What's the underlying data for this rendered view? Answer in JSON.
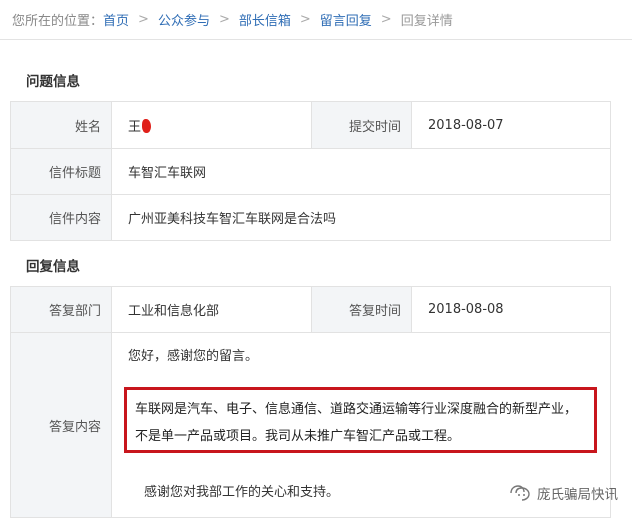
{
  "breadcrumb": {
    "prefix": "您所在的位置：",
    "items": [
      "首页",
      "公众参与",
      "部长信箱",
      "留言回复"
    ],
    "current": "回复详情"
  },
  "question": {
    "section_title": "问题信息",
    "name_label": "姓名",
    "name_value": "王",
    "time_label": "提交时间",
    "time_value": "2018-08-07",
    "subject_label": "信件标题",
    "subject_value": "车智汇车联网",
    "content_label": "信件内容",
    "content_value": "广州亚美科技车智汇车联网是合法吗"
  },
  "reply": {
    "section_title": "回复信息",
    "dept_label": "答复部门",
    "dept_value": "工业和信息化部",
    "time_label": "答复时间",
    "time_value": "2018-08-08",
    "content_label": "答复内容",
    "greeting": "您好，感谢您的留言。",
    "body": "车联网是汽车、电子、信息通信、道路交通运输等行业深度融合的新型产业，不是单一产品或项目。我司从未推广车智汇产品或工程。",
    "closing": "感谢您对我部工作的关心和支持。"
  },
  "watermark": {
    "text": "庞氏骗局快讯",
    "icon": "wechat-channel-icon"
  },
  "colors": {
    "link": "#2f6db5",
    "label_bg": "#f3f5f7",
    "border": "#e2e2e2",
    "highlight_box": "#c8161d"
  }
}
